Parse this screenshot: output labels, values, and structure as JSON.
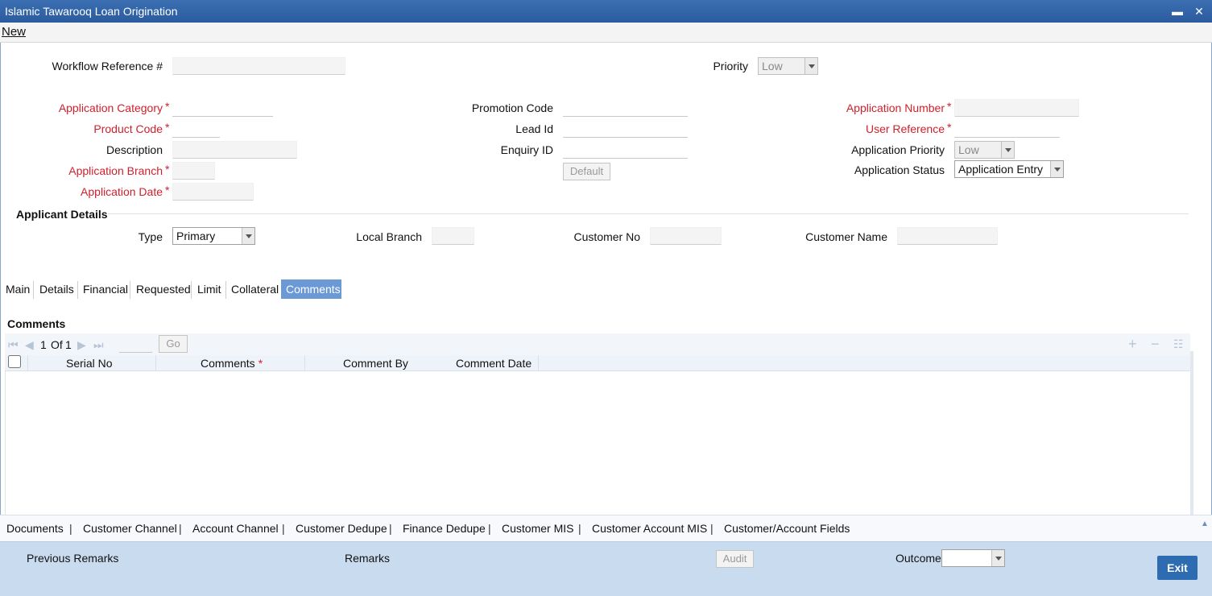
{
  "window": {
    "title": "Islamic Tawarooq Loan Origination",
    "minimize_glyph": "▬",
    "close_glyph": "✕"
  },
  "menu": {
    "new_label": "New"
  },
  "header": {
    "workflow_ref_label": "Workflow Reference #",
    "workflow_ref_value": "",
    "priority_label": "Priority",
    "priority_value": "Low"
  },
  "form": {
    "app_category_label": "Application Category",
    "app_category_value": "",
    "product_code_label": "Product Code",
    "product_code_value": "",
    "description_label": "Description",
    "description_value": "",
    "app_branch_label": "Application Branch",
    "app_branch_value": "",
    "app_date_label": "Application Date",
    "app_date_value": "",
    "promotion_code_label": "Promotion Code",
    "promotion_code_value": "",
    "lead_id_label": "Lead Id",
    "lead_id_value": "",
    "enquiry_id_label": "Enquiry ID",
    "enquiry_id_value": "",
    "default_button": "Default",
    "app_number_label": "Application Number",
    "app_number_value": "",
    "user_ref_label": "User Reference",
    "user_ref_value": "",
    "app_priority_label": "Application Priority",
    "app_priority_value": "Low",
    "app_status_label": "Application Status",
    "app_status_value": "Application Entry",
    "required_mark": "*"
  },
  "applicant": {
    "section_title": "Applicant Details",
    "type_label": "Type",
    "type_value": "Primary",
    "local_branch_label": "Local Branch",
    "local_branch_value": "",
    "customer_no_label": "Customer No",
    "customer_no_value": "",
    "customer_name_label": "Customer Name",
    "customer_name_value": ""
  },
  "tabs": [
    {
      "label": "Main",
      "active": false
    },
    {
      "label": "Details",
      "active": false
    },
    {
      "label": "Financial",
      "active": false
    },
    {
      "label": "Requested",
      "active": false
    },
    {
      "label": "Limit",
      "active": false
    },
    {
      "label": "Collateral",
      "active": false
    },
    {
      "label": "Comments",
      "active": true
    }
  ],
  "comments": {
    "section_title": "Comments",
    "pager_current": "1",
    "pager_of": "Of",
    "pager_total": "1",
    "go_button": "Go",
    "columns": [
      "Serial No",
      "Comments",
      "Comment By",
      "Comment Date"
    ],
    "rows": []
  },
  "footer_links": [
    "Documents",
    "Customer Channel",
    "Account Channel",
    "Customer Dedupe",
    "Finance Dedupe",
    "Customer MIS",
    "Customer Account MIS",
    "Customer/Account Fields"
  ],
  "footer": {
    "previous_remarks_label": "Previous Remarks",
    "remarks_label": "Remarks",
    "audit_button": "Audit",
    "outcome_label": "Outcome",
    "outcome_value": "",
    "exit_button": "Exit"
  },
  "colors": {
    "titlebar": "#2f63a8",
    "required": "#d0202c",
    "active_tab": "#6a99d6",
    "footer_bg": "#c9dcef",
    "exit_button": "#2d6cb1"
  }
}
